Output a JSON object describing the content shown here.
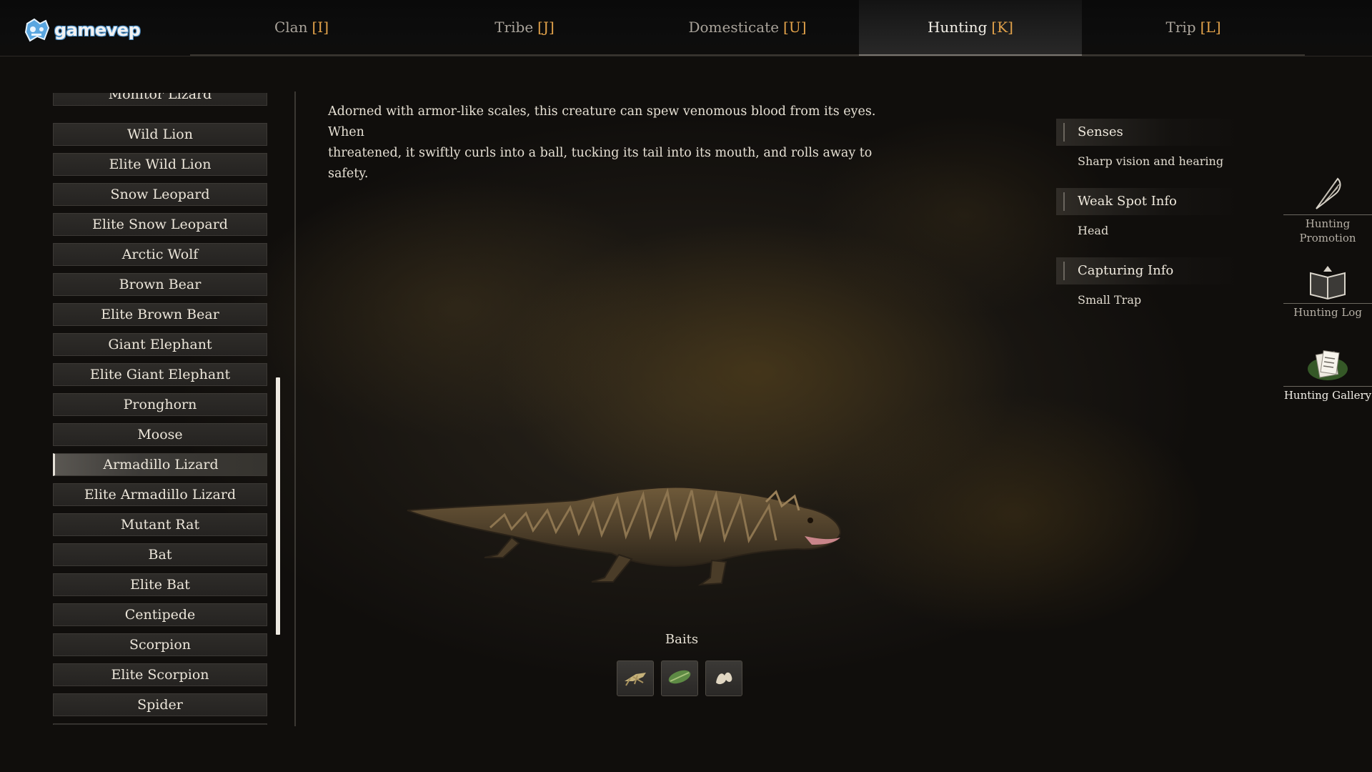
{
  "logo": {
    "text": "gamevep"
  },
  "tabs": [
    {
      "label": "Clan",
      "key": "[I]",
      "active": false
    },
    {
      "label": "Tribe",
      "key": "[J]",
      "active": false
    },
    {
      "label": "Domesticate",
      "key": "[U]",
      "active": false
    },
    {
      "label": "Hunting",
      "key": "[K]",
      "active": true
    },
    {
      "label": "Trip",
      "key": "[L]",
      "active": false
    }
  ],
  "creatures": {
    "partial_top": "Monitor Lizard",
    "items": [
      "Wild Lion",
      "Elite Wild Lion",
      "Snow Leopard",
      "Elite Snow Leopard",
      "Arctic Wolf",
      "Brown Bear",
      "Elite Brown Bear",
      "Giant Elephant",
      "Elite Giant Elephant",
      "Pronghorn",
      "Moose",
      "Armadillo Lizard",
      "Elite Armadillo Lizard",
      "Mutant Rat",
      "Bat",
      "Elite Bat",
      "Centipede",
      "Scorpion",
      "Elite Scorpion",
      "Spider"
    ],
    "selected": "Armadillo Lizard"
  },
  "description": {
    "line1": "Adorned with armor-like scales, this creature can spew venomous blood from its eyes. When",
    "line2": "threatened, it swiftly curls into a ball, tucking its tail into its mouth, and rolls away to safety."
  },
  "info": {
    "senses": {
      "title": "Senses",
      "value": "Sharp vision and hearing"
    },
    "weak_spot": {
      "title": "Weak Spot Info",
      "value": "Head"
    },
    "capturing": {
      "title": "Capturing Info",
      "value": "Small Trap"
    }
  },
  "baits": {
    "title": "Baits",
    "items": [
      "grasshopper-icon",
      "leaf-beetle-icon",
      "grub-icon"
    ]
  },
  "side_buttons": {
    "promotion": {
      "line1": "Hunting",
      "line2": "Promotion",
      "icon": "feather-quill-icon"
    },
    "log": {
      "label": "Hunting Log",
      "icon": "open-book-icon"
    },
    "gallery": {
      "label": "Hunting Gallery",
      "icon": "scroll-papers-icon"
    }
  },
  "colors": {
    "key_accent": "#e2a24a",
    "text": "#e6e0d4",
    "scrollbar": "#eeeae2"
  }
}
